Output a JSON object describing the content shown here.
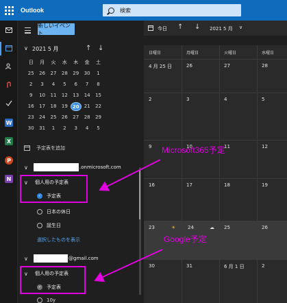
{
  "app": {
    "title": "Outlook"
  },
  "search": {
    "placeholder": "検索"
  },
  "rail": {
    "icons": [
      "mail-icon",
      "calendar-icon",
      "people-icon",
      "attach-icon",
      "todo-icon",
      "word-icon",
      "excel-icon",
      "powerpoint-icon",
      "onenote-icon"
    ]
  },
  "pane": {
    "new_event": "新しいイベント",
    "mini_month": "2021 5 月",
    "weekdays": [
      "日",
      "月",
      "火",
      "水",
      "木",
      "金",
      "土"
    ],
    "weeks": [
      [
        "25",
        "26",
        "27",
        "28",
        "29",
        "30",
        "1"
      ],
      [
        "2",
        "3",
        "4",
        "5",
        "6",
        "7",
        "8"
      ],
      [
        "9",
        "10",
        "11",
        "12",
        "13",
        "14",
        "15"
      ],
      [
        "16",
        "17",
        "18",
        "19",
        "20",
        "21",
        "22"
      ],
      [
        "23",
        "24",
        "25",
        "26",
        "27",
        "28",
        "29"
      ],
      [
        "30",
        "31",
        "1",
        "2",
        "3",
        "4",
        "5"
      ]
    ],
    "selected_day": "20",
    "add_calendar": "予定表を追加",
    "account1_suffix": ".onmicrosoft.com",
    "group1": "個人用の予定表",
    "cal_default": "予定表",
    "cal_japan_holidays": "日本の休日",
    "cal_birthdays": "誕生日",
    "show_selected": "選択したものを表示",
    "account2_suffix": "@gmail.com",
    "group2": "個人用の予定表",
    "cal_default2": "予定表",
    "cal_more": "10y"
  },
  "toolbar": {
    "today": "今日",
    "month": "2021 5 月"
  },
  "main": {
    "day_headers": [
      "日曜日",
      "月曜日",
      "火曜日",
      "水曜日"
    ],
    "rows": [
      [
        "4 月 25 日",
        "26",
        "27",
        "28"
      ],
      [
        "2",
        "3",
        "4",
        "5"
      ],
      [
        "9",
        "10",
        "11",
        "12"
      ],
      [
        "16",
        "17",
        "18",
        "19"
      ],
      [
        "23",
        "24",
        "25",
        "26"
      ],
      [
        "30",
        "31",
        "6 月 1 日",
        "2"
      ]
    ]
  },
  "annotations": {
    "ms365": "Microsoft365予定",
    "google": "Google予定"
  },
  "colors": {
    "accent": "#0f6cbd",
    "highlight": "#e000e0",
    "today": "#3a8ee6"
  }
}
